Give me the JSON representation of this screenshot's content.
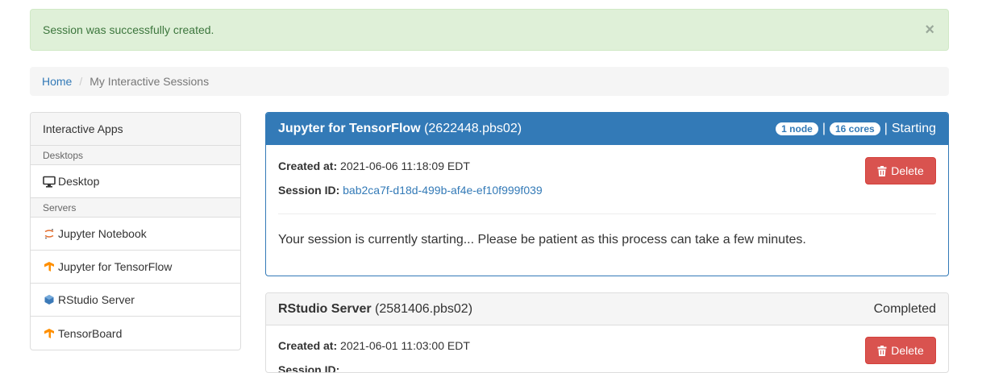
{
  "alert": {
    "message": "Session was successfully created.",
    "close": "×"
  },
  "breadcrumb": {
    "home": "Home",
    "current": "My Interactive Sessions"
  },
  "sidebar": {
    "title": "Interactive Apps",
    "sections": [
      {
        "label": "Desktops",
        "items": [
          {
            "label": "Desktop",
            "icon": "monitor-icon"
          }
        ]
      },
      {
        "label": "Servers",
        "items": [
          {
            "label": "Jupyter Notebook",
            "icon": "jupyter-icon"
          },
          {
            "label": "Jupyter for TensorFlow",
            "icon": "tensorflow-icon"
          },
          {
            "label": "RStudio Server",
            "icon": "rstudio-icon"
          },
          {
            "label": "TensorBoard",
            "icon": "tensorflow-icon"
          }
        ]
      }
    ]
  },
  "sessions": [
    {
      "name": "Jupyter for TensorFlow",
      "id": "(2622448.pbs02)",
      "nodes": "1 node",
      "cores": "16 cores",
      "sep": "|",
      "status": "Starting",
      "created_label": "Created at:",
      "created": "2021-06-06 11:18:09 EDT",
      "session_label": "Session ID:",
      "session_id": "bab2ca7f-d18d-499b-af4e-ef10f999f039",
      "delete": "Delete",
      "message": "Your session is currently starting... Please be patient as this process can take a few minutes."
    },
    {
      "name": "RStudio Server",
      "id": "(2581406.pbs02)",
      "status": "Completed",
      "created_label": "Created at:",
      "created": "2021-06-01 11:03:00 EDT",
      "session_label": "Session ID:",
      "delete": "Delete"
    }
  ],
  "colors": {
    "primary": "#337ab7",
    "danger": "#d9534f",
    "success_bg": "#dff0d8",
    "success_text": "#3c763d"
  }
}
